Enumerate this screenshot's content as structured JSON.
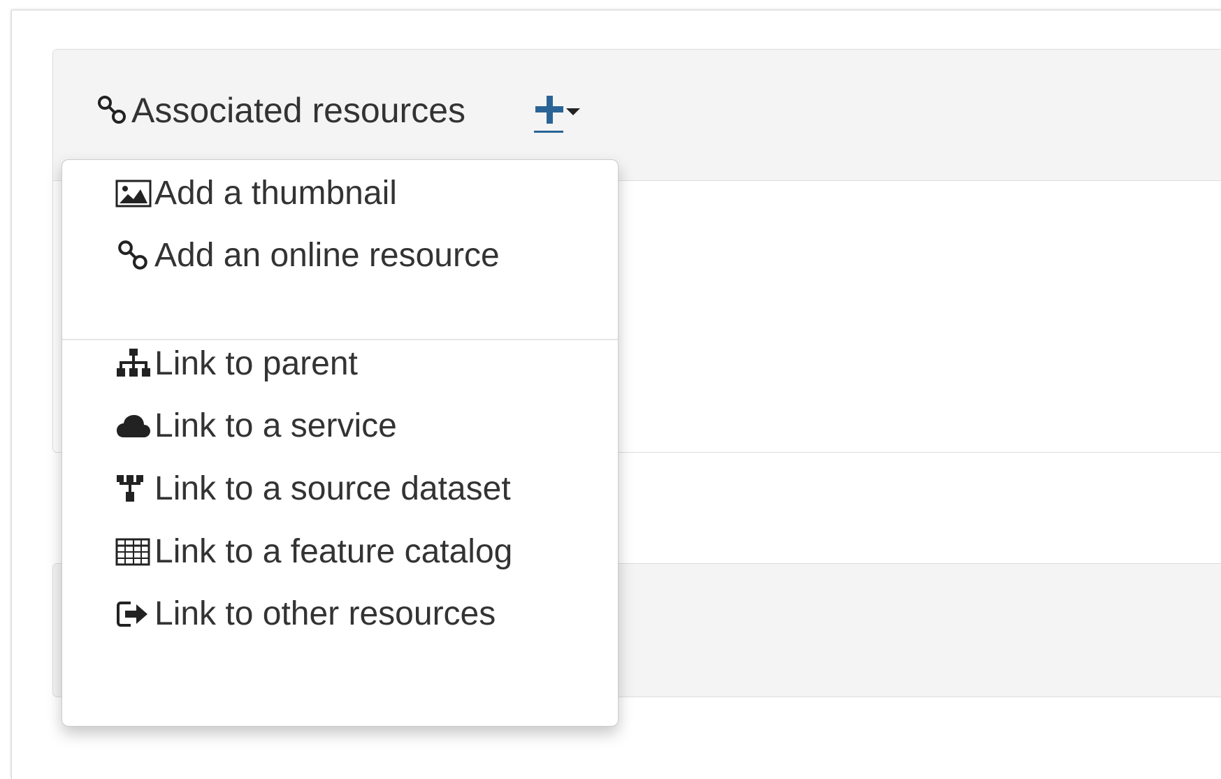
{
  "panel": {
    "title": "Associated resources",
    "title_icon": "link-icon",
    "add_button_icon": "plus-icon",
    "accent_color": "#2a6496"
  },
  "dropdown": {
    "items": [
      {
        "label": "Add a thumbnail",
        "icon": "picture-icon"
      },
      {
        "label": "Add an online resource",
        "icon": "link-icon"
      },
      {
        "label": "Link to parent",
        "icon": "sitemap-icon"
      },
      {
        "label": "Link to a service",
        "icon": "cloud-icon"
      },
      {
        "label": "Link to a source dataset",
        "icon": "source-dataset-icon"
      },
      {
        "label": "Link to a feature catalog",
        "icon": "table-icon"
      },
      {
        "label": "Link to other resources",
        "icon": "sign-out-icon"
      }
    ]
  }
}
